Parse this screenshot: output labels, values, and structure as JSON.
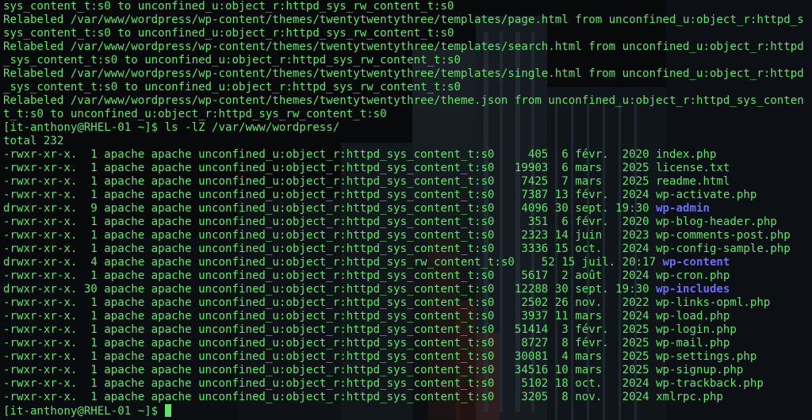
{
  "terminal": {
    "lines": [
      {
        "text": "sys_content_t:s0 to unconfined_u:object_r:httpd_sys_rw_content_t:s0"
      },
      {
        "text": "Relabeled /var/www/wordpress/wp-content/themes/twentytwentythree/templates/page.html from unconfined_u:object_r:httpd_s"
      },
      {
        "text": "sys_content_t:s0 to unconfined_u:object_r:httpd_sys_rw_content_t:s0"
      },
      {
        "text": "Relabeled /var/www/wordpress/wp-content/themes/twentytwentythree/templates/search.html from unconfined_u:object_r:httpd"
      },
      {
        "text": "_sys_content_t:s0 to unconfined_u:object_r:httpd_sys_rw_content_t:s0"
      },
      {
        "text": "Relabeled /var/www/wordpress/wp-content/themes/twentytwentythree/templates/single.html from unconfined_u:object_r:httpd"
      },
      {
        "text": "_sys_content_t:s0 to unconfined_u:object_r:httpd_sys_rw_content_t:s0"
      },
      {
        "text": "Relabeled /var/www/wordpress/wp-content/themes/twentytwentythree/theme.json from unconfined_u:object_r:httpd_sys_conten"
      },
      {
        "text": "t_t:s0 to unconfined_u:object_r:httpd_sys_rw_content_t:s0"
      },
      {
        "text": "[it-anthony@RHEL-01 ~]$ ls -lZ /var/www/wordpress/"
      },
      {
        "text": "total 232"
      },
      {
        "text": "-rwxr-xr-x.  1 apache apache unconfined_u:object_r:httpd_sys_content_t:s0     405  6 févr.  2020 ",
        "name": "index.php"
      },
      {
        "text": "-rwxr-xr-x.  1 apache apache unconfined_u:object_r:httpd_sys_content_t:s0   19903  6 mars   2025 ",
        "name": "license.txt"
      },
      {
        "text": "-rwxr-xr-x.  1 apache apache unconfined_u:object_r:httpd_sys_content_t:s0    7425  7 mars   2025 ",
        "name": "readme.html"
      },
      {
        "text": "-rwxr-xr-x.  1 apache apache unconfined_u:object_r:httpd_sys_content_t:s0    7387 13 févr.  2024 ",
        "name": "wp-activate.php"
      },
      {
        "text": "drwxr-xr-x.  9 apache apache unconfined_u:object_r:httpd_sys_content_t:s0    4096 30 sept. 19:30 ",
        "name": "wp-admin",
        "dir": true
      },
      {
        "text": "-rwxr-xr-x.  1 apache apache unconfined_u:object_r:httpd_sys_content_t:s0     351  6 févr.  2020 ",
        "name": "wp-blog-header.php"
      },
      {
        "text": "-rwxr-xr-x.  1 apache apache unconfined_u:object_r:httpd_sys_content_t:s0    2323 14 juin   2023 ",
        "name": "wp-comments-post.php"
      },
      {
        "text": "-rwxr-xr-x.  1 apache apache unconfined_u:object_r:httpd_sys_content_t:s0    3336 15 oct.   2024 ",
        "name": "wp-config-sample.php"
      },
      {
        "text": "drwxr-xr-x.  4 apache apache unconfined_u:object_r:httpd_sys_rw_content_t:s0    52 15 juil. 20:17 ",
        "name": "wp-content",
        "dir": true
      },
      {
        "text": "-rwxr-xr-x.  1 apache apache unconfined_u:object_r:httpd_sys_content_t:s0    5617  2 août   2024 ",
        "name": "wp-cron.php"
      },
      {
        "text": "drwxr-xr-x. 30 apache apache unconfined_u:object_r:httpd_sys_content_t:s0   12288 30 sept. 19:30 ",
        "name": "wp-includes",
        "dir": true
      },
      {
        "text": "-rwxr-xr-x.  1 apache apache unconfined_u:object_r:httpd_sys_content_t:s0    2502 26 nov.   2022 ",
        "name": "wp-links-opml.php"
      },
      {
        "text": "-rwxr-xr-x.  1 apache apache unconfined_u:object_r:httpd_sys_content_t:s0    3937 11 mars   2024 ",
        "name": "wp-load.php"
      },
      {
        "text": "-rwxr-xr-x.  1 apache apache unconfined_u:object_r:httpd_sys_content_t:s0   51414  3 févr.  2025 ",
        "name": "wp-login.php"
      },
      {
        "text": "-rwxr-xr-x.  1 apache apache unconfined_u:object_r:httpd_sys_content_t:s0    8727  8 févr.  2025 ",
        "name": "wp-mail.php"
      },
      {
        "text": "-rwxr-xr-x.  1 apache apache unconfined_u:object_r:httpd_sys_content_t:s0   30081  4 mars   2025 ",
        "name": "wp-settings.php"
      },
      {
        "text": "-rwxr-xr-x.  1 apache apache unconfined_u:object_r:httpd_sys_content_t:s0   34516 10 mars   2025 ",
        "name": "wp-signup.php"
      },
      {
        "text": "-rwxr-xr-x.  1 apache apache unconfined_u:object_r:httpd_sys_content_t:s0    5102 18 oct.   2024 ",
        "name": "wp-trackback.php"
      },
      {
        "text": "-rwxr-xr-x.  1 apache apache unconfined_u:object_r:httpd_sys_content_t:s0    3205  8 nov.   2024 ",
        "name": "xmlrpc.php"
      }
    ],
    "prompt": "[it-anthony@RHEL-01 ~]$ "
  },
  "colors": {
    "text": "#5fe46a",
    "directory": "#6b6df2",
    "background": "#06080a"
  }
}
